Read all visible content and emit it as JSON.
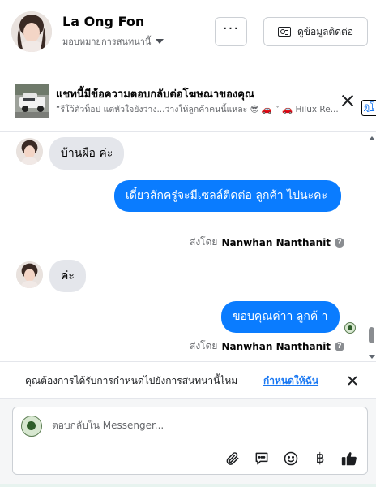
{
  "header": {
    "name": "La Ong Fon",
    "assign_label": "มอบหมายการสนทนานี้",
    "more_label": "···",
    "contact_button": "ดูข้อมูลติดต่อ"
  },
  "ad_banner": {
    "title": "แชทนี้มีข้อความตอบกลับต่อโฆษณาของคุณ",
    "subtitle": "“รีโว้ตัวท็อป แต่หัวใจยังว่าง...ว่างให้ลูกค้าคนนี้แหละ 😎 🚗 ” 🚗 Hilux Re...",
    "link": "ดูโ"
  },
  "messages": [
    {
      "direction": "in",
      "text": "บ้านผือ ค่ะ"
    },
    {
      "direction": "out",
      "text": "เดี๋ยวสักครู่จะมีเซลล์ติดต่อ ลูกค้า ไปนะคะ",
      "sent_by_prefix": "ส่งโดย",
      "sent_by_name": "Nanwhan Nanthanit"
    },
    {
      "direction": "in",
      "text": "ค่ะ"
    },
    {
      "direction": "out",
      "text": "ขอบคุณค่าา ลูกค้ า",
      "sent_by_prefix": "ส่งโดย",
      "sent_by_name": "Nanwhan Nanthanit"
    }
  ],
  "prompt": {
    "text": "คุณต้องการได้รับการกำหนดไปยังการสนทนานี้ไหม",
    "link": "กำหนดให้ฉัน"
  },
  "composer": {
    "placeholder": "ตอบกลับใน Messenger...",
    "icons": [
      "paperclip-icon",
      "chat-bubble-icon",
      "smiley-icon",
      "baht-icon",
      "thumbs-up-icon"
    ],
    "baht_symbol": "฿"
  },
  "colors": {
    "outgoing_bubble": "#0a7cff",
    "incoming_bubble": "#e4e6eb",
    "link": "#1877f2"
  }
}
